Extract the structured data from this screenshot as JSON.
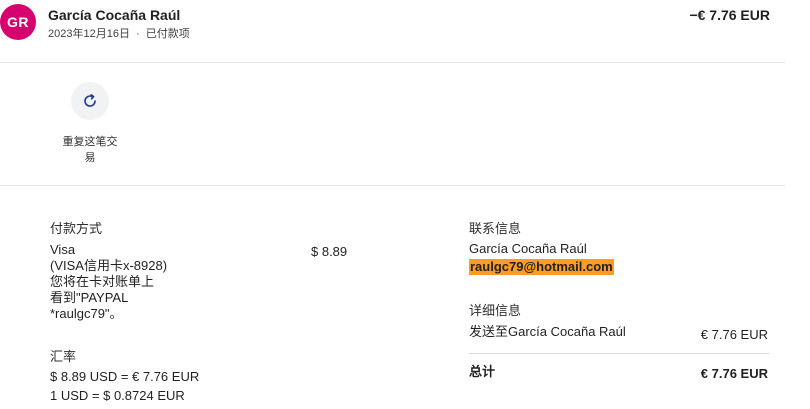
{
  "header": {
    "avatar_initials": "GR",
    "name": "García Cocaña Raúl",
    "date": "2023年12月16日",
    "separator": "·",
    "status": "已付款项",
    "amount": "−€ 7.76 EUR"
  },
  "actions": {
    "repeat_label": "重复这笔交易",
    "repeat_icon": "refresh-icon"
  },
  "payment": {
    "heading": "付款方式",
    "lines": [
      "Visa",
      "(VISA信用卡x-8928)",
      "您将在卡对账单上",
      "看到\"PAYPAL",
      "*raulgc79\"。"
    ],
    "amount": "$ 8.89"
  },
  "exchange": {
    "heading": "汇率",
    "line1": "$ 8.89 USD = € 7.76 EUR",
    "line2": "1 USD = $ 0.8724 EUR"
  },
  "contact": {
    "heading": "联系信息",
    "name": "García Cocaña Raúl",
    "email": "raulgc79@hotmail.com"
  },
  "details": {
    "heading": "详细信息",
    "sent_to_label": "发送至García Cocaña Raúl",
    "sent_amount": "€ 7.76 EUR",
    "total_label": "总计",
    "total_amount": "€ 7.76 EUR"
  },
  "colors": {
    "avatar": "#d6006e",
    "email_highlight": "#ff9b26"
  }
}
